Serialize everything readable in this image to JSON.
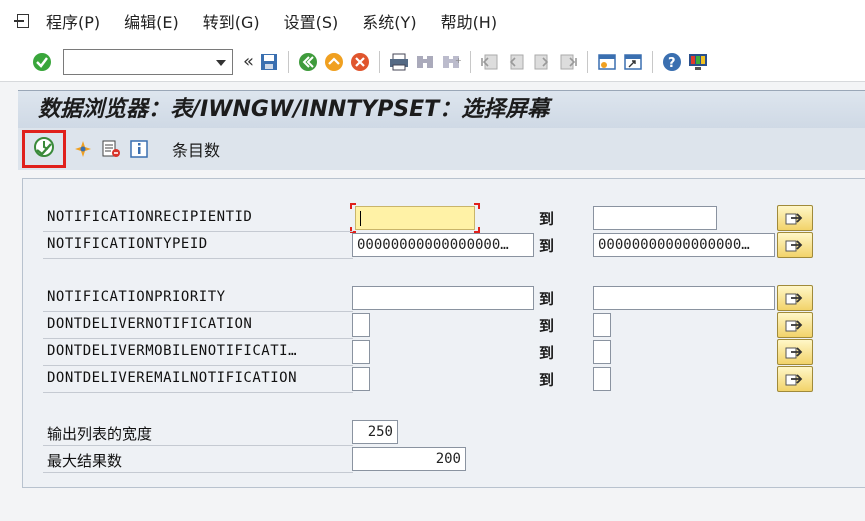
{
  "menu": {
    "items": [
      {
        "id": "program",
        "label": "程序(P)"
      },
      {
        "id": "edit",
        "label": "编辑(E)"
      },
      {
        "id": "goto",
        "label": "转到(G)"
      },
      {
        "id": "settings",
        "label": "设置(S)"
      },
      {
        "id": "system",
        "label": "系统(Y)"
      },
      {
        "id": "help",
        "label": "帮助(H)"
      }
    ]
  },
  "toolbar": {
    "command_value": "",
    "double_arrow": "«"
  },
  "title": "数据浏览器：表/IWNGW/INNTYPSET：选择屏幕",
  "app_toolbar": {
    "entries_label": "条目数"
  },
  "fields": [
    {
      "label": "NOTIFICATIONRECIPIENTID",
      "from": "",
      "to_label": "到",
      "to": ""
    },
    {
      "label": "NOTIFICATIONTYPEID",
      "from": "00000000000000000…",
      "to_label": "到",
      "to": "00000000000000000…"
    },
    {
      "label": "NOTIFICATIONPRIORITY",
      "from": "",
      "to_label": "到",
      "to": ""
    },
    {
      "label": "DONTDELIVERNOTIFICATION",
      "from": "",
      "to_label": "到",
      "to": ""
    },
    {
      "label": "DONTDELIVERMOBILENOTIFICATI…",
      "from": "",
      "to_label": "到",
      "to": ""
    },
    {
      "label": "DONTDELIVEREMAILNOTIFICATION",
      "from": "",
      "to_label": "到",
      "to": ""
    }
  ],
  "output": {
    "width_label": "输出列表的宽度",
    "width_value": "250",
    "max_label": "最大结果数",
    "max_value": "200"
  },
  "colors": {
    "focus_field": "#fff2a6",
    "highlight_border": "#e0201c",
    "title_bg": "#d4dde8"
  }
}
